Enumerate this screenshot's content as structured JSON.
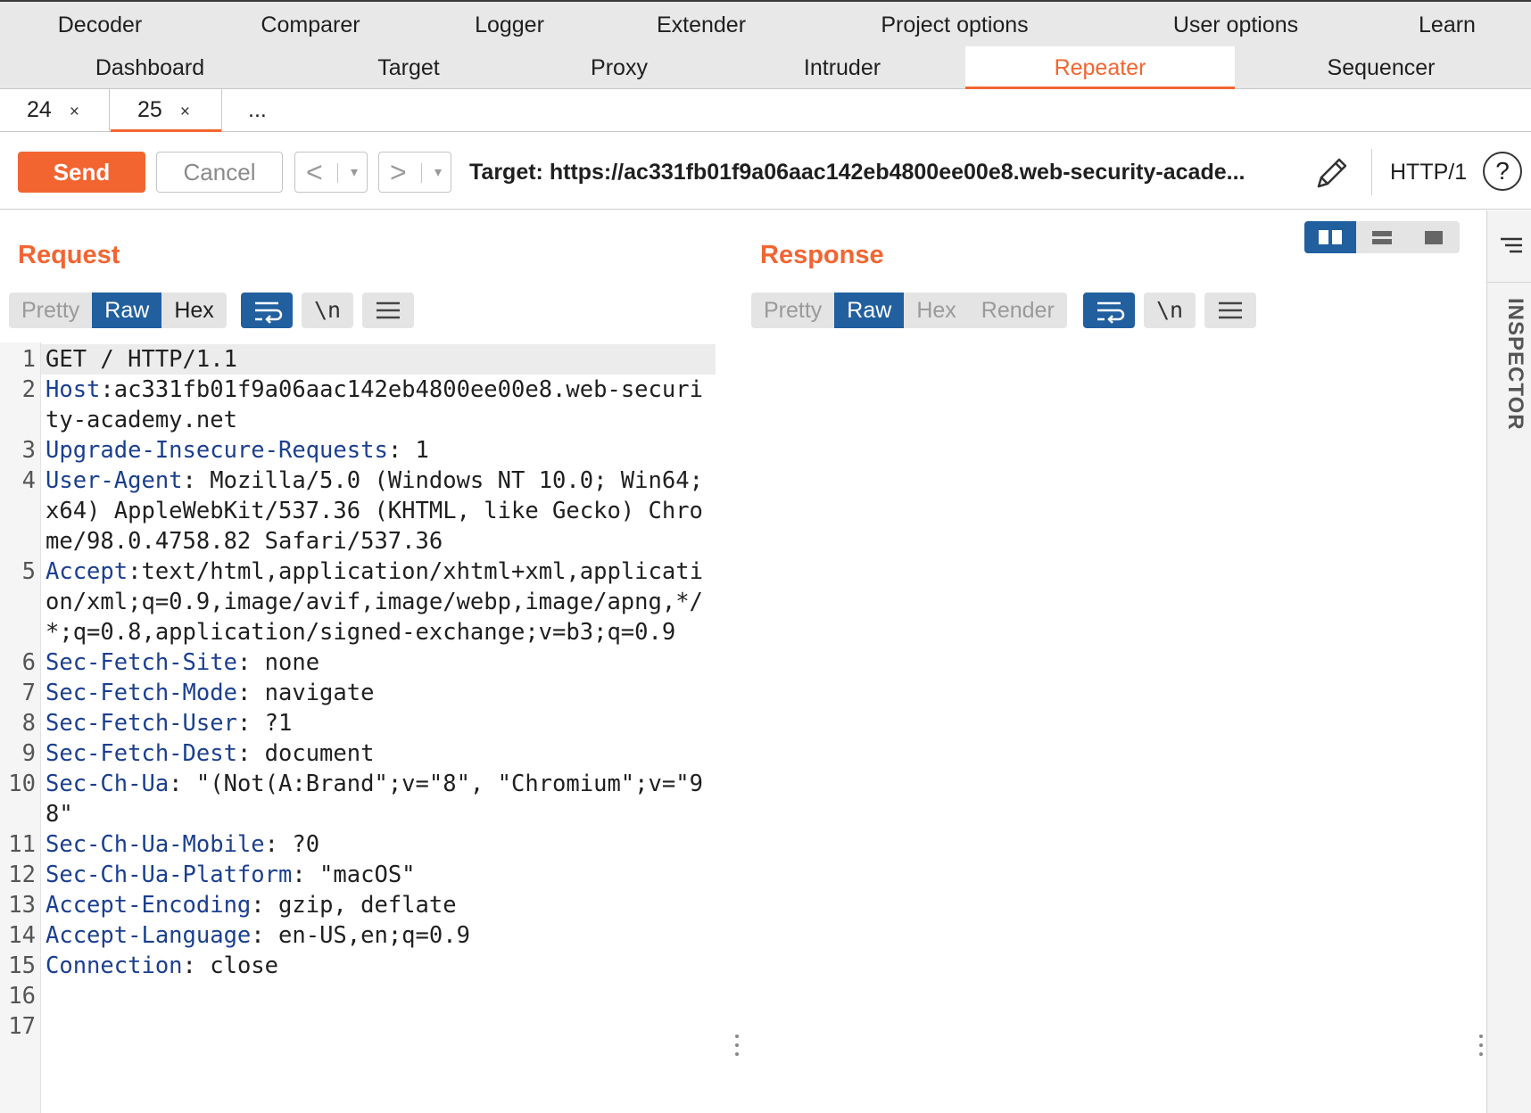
{
  "top_tabs": {
    "row1": [
      "Decoder",
      "Comparer",
      "Logger",
      "Extender",
      "Project options",
      "User options",
      "Learn"
    ],
    "row2": [
      "Dashboard",
      "Target",
      "Proxy",
      "Intruder",
      "Repeater",
      "Sequencer"
    ],
    "active": "Repeater"
  },
  "repeater_tabs": [
    {
      "label": "24",
      "close": "×"
    },
    {
      "label": "25",
      "close": "×"
    },
    {
      "label": "..."
    }
  ],
  "toolbar": {
    "send_label": "Send",
    "cancel_label": "Cancel",
    "back_glyph": "<",
    "forward_glyph": ">",
    "dropdown_glyph": "▾",
    "target_text": "Target: https://ac331fb01f9a06aac142eb4800ee00e8.web-security-acade...",
    "http_version": "HTTP/1",
    "help_glyph": "?"
  },
  "request": {
    "title": "Request",
    "views": [
      "Pretty",
      "Raw",
      "Hex"
    ],
    "selected_view": "Raw",
    "newline_toggle": "\\n",
    "lines": [
      {
        "n": "1",
        "key": "",
        "val": "GET / HTTP/1.1"
      },
      {
        "n": "2",
        "key": "Host",
        "val": "ac331fb01f9a06aac142eb4800ee00e8.web-security-academy.net"
      },
      {
        "n": "3",
        "key": "Upgrade-Insecure-Requests",
        "val": " 1"
      },
      {
        "n": "4",
        "key": "User-Agent",
        "val": " Mozilla/5.0 (Windows NT 10.0; Win64; x64) AppleWebKit/537.36 (KHTML, like Gecko) Chrome/98.0.4758.82 Safari/537.36"
      },
      {
        "n": "5",
        "key": "Accept",
        "val": "text/html,application/xhtml+xml,application/xml;q=0.9,image/avif,image/webp,image/apng,*/*;q=0.8,application/signed-exchange;v=b3;q=0.9"
      },
      {
        "n": "6",
        "key": "Sec-Fetch-Site",
        "val": " none"
      },
      {
        "n": "7",
        "key": "Sec-Fetch-Mode",
        "val": " navigate"
      },
      {
        "n": "8",
        "key": "Sec-Fetch-User",
        "val": " ?1"
      },
      {
        "n": "9",
        "key": "Sec-Fetch-Dest",
        "val": " document"
      },
      {
        "n": "10",
        "key": "Sec-Ch-Ua",
        "val": " \"(Not(A:Brand\";v=\"8\", \"Chromium\";v=\"98\""
      },
      {
        "n": "11",
        "key": "Sec-Ch-Ua-Mobile",
        "val": " ?0"
      },
      {
        "n": "12",
        "key": "Sec-Ch-Ua-Platform",
        "val": " \"macOS\""
      },
      {
        "n": "13",
        "key": "Accept-Encoding",
        "val": " gzip, deflate"
      },
      {
        "n": "14",
        "key": "Accept-Language",
        "val": " en-US,en;q=0.9"
      },
      {
        "n": "15",
        "key": "Connection",
        "val": " close"
      },
      {
        "n": "16",
        "key": "",
        "val": ""
      },
      {
        "n": "17",
        "key": "",
        "val": ""
      }
    ]
  },
  "response": {
    "title": "Response",
    "views": [
      "Pretty",
      "Raw",
      "Hex",
      "Render"
    ],
    "selected_view": "Raw",
    "newline_toggle": "\\n"
  },
  "inspector": {
    "label": "INSPECTOR"
  },
  "colors": {
    "accent": "#f26531",
    "selected": "#215f9f",
    "header_key": "#1b3f8f"
  }
}
